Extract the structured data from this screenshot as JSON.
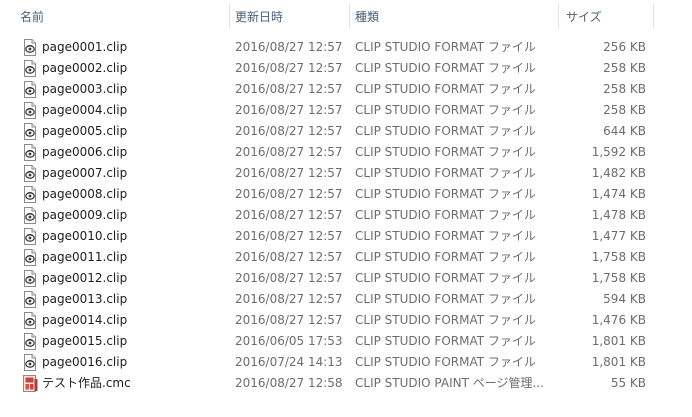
{
  "columns": {
    "name": "名前",
    "date": "更新日時",
    "type": "種類",
    "size": "サイズ"
  },
  "files": [
    {
      "name": "page0001.clip",
      "date": "2016/08/27 12:57",
      "type": "CLIP STUDIO FORMAT ファイル",
      "size": "256 KB",
      "icon": "clip-file-icon"
    },
    {
      "name": "page0002.clip",
      "date": "2016/08/27 12:57",
      "type": "CLIP STUDIO FORMAT ファイル",
      "size": "258 KB",
      "icon": "clip-file-icon"
    },
    {
      "name": "page0003.clip",
      "date": "2016/08/27 12:57",
      "type": "CLIP STUDIO FORMAT ファイル",
      "size": "258 KB",
      "icon": "clip-file-icon"
    },
    {
      "name": "page0004.clip",
      "date": "2016/08/27 12:57",
      "type": "CLIP STUDIO FORMAT ファイル",
      "size": "258 KB",
      "icon": "clip-file-icon"
    },
    {
      "name": "page0005.clip",
      "date": "2016/08/27 12:57",
      "type": "CLIP STUDIO FORMAT ファイル",
      "size": "644 KB",
      "icon": "clip-file-icon"
    },
    {
      "name": "page0006.clip",
      "date": "2016/08/27 12:57",
      "type": "CLIP STUDIO FORMAT ファイル",
      "size": "1,592 KB",
      "icon": "clip-file-icon"
    },
    {
      "name": "page0007.clip",
      "date": "2016/08/27 12:57",
      "type": "CLIP STUDIO FORMAT ファイル",
      "size": "1,482 KB",
      "icon": "clip-file-icon"
    },
    {
      "name": "page0008.clip",
      "date": "2016/08/27 12:57",
      "type": "CLIP STUDIO FORMAT ファイル",
      "size": "1,474 KB",
      "icon": "clip-file-icon"
    },
    {
      "name": "page0009.clip",
      "date": "2016/08/27 12:57",
      "type": "CLIP STUDIO FORMAT ファイル",
      "size": "1,478 KB",
      "icon": "clip-file-icon"
    },
    {
      "name": "page0010.clip",
      "date": "2016/08/27 12:57",
      "type": "CLIP STUDIO FORMAT ファイル",
      "size": "1,477 KB",
      "icon": "clip-file-icon"
    },
    {
      "name": "page0011.clip",
      "date": "2016/08/27 12:57",
      "type": "CLIP STUDIO FORMAT ファイル",
      "size": "1,758 KB",
      "icon": "clip-file-icon"
    },
    {
      "name": "page0012.clip",
      "date": "2016/08/27 12:57",
      "type": "CLIP STUDIO FORMAT ファイル",
      "size": "1,758 KB",
      "icon": "clip-file-icon"
    },
    {
      "name": "page0013.clip",
      "date": "2016/08/27 12:57",
      "type": "CLIP STUDIO FORMAT ファイル",
      "size": "594 KB",
      "icon": "clip-file-icon"
    },
    {
      "name": "page0014.clip",
      "date": "2016/08/27 12:57",
      "type": "CLIP STUDIO FORMAT ファイル",
      "size": "1,476 KB",
      "icon": "clip-file-icon"
    },
    {
      "name": "page0015.clip",
      "date": "2016/06/05 17:53",
      "type": "CLIP STUDIO FORMAT ファイル",
      "size": "1,801 KB",
      "icon": "clip-file-icon"
    },
    {
      "name": "page0016.clip",
      "date": "2016/07/24 14:13",
      "type": "CLIP STUDIO FORMAT ファイル",
      "size": "1,801 KB",
      "icon": "clip-file-icon"
    },
    {
      "name": "テスト作品.cmc",
      "date": "2016/08/27 12:58",
      "type": "CLIP STUDIO PAINT ページ管理...",
      "size": "55 KB",
      "icon": "cmc-file-icon"
    }
  ],
  "colors": {
    "header_text": "#4c607a",
    "name_text": "#1e1e1e",
    "detail_text": "#6d6d6d",
    "column_separator": "#e5e5e5"
  }
}
